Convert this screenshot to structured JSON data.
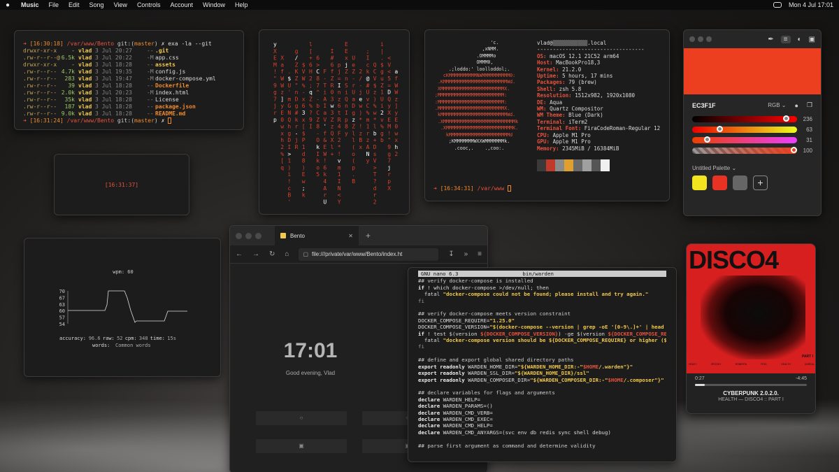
{
  "menubar": {
    "app": "Music",
    "items": [
      "File",
      "Edit",
      "Song",
      "View",
      "Controls",
      "Account",
      "Window",
      "Help"
    ],
    "datetime": "Mon 4 Jul  17:01"
  },
  "terminal1": {
    "prompt_time": "[16:30:18]",
    "path": "/var/www/Bento",
    "git_label": "git:(",
    "branch": "master",
    "git_close": ")",
    "cmd": "✗ exa -la --git",
    "rows": [
      {
        "perm": "drwxr-xr-x",
        "size": "-",
        "user": "vlad",
        "date": "3 Jul 20:27",
        "git": "--",
        "name": ".git",
        "kind": "dir"
      },
      {
        "perm": ".rw-r--r--@",
        "size": "6.5k",
        "user": "vlad",
        "date": "3 Jul 20:22",
        "git": "-M",
        "name": "app.css",
        "kind": "file"
      },
      {
        "perm": "drwxr-xr-x",
        "size": "-",
        "user": "vlad",
        "date": "3 Jul 18:28",
        "git": "--",
        "name": "assets",
        "kind": "dir"
      },
      {
        "perm": ".rw-r--r--",
        "size": "4.7k",
        "user": "vlad",
        "date": "3 Jul 19:35",
        "git": "-M",
        "name": "config.js",
        "kind": "file"
      },
      {
        "perm": ".rw-r--r--",
        "size": "283",
        "user": "vlad",
        "date": "3 Jul 19:47",
        "git": "-M",
        "name": "docker-compose.yml",
        "kind": "file"
      },
      {
        "perm": ".rw-r--r--",
        "size": "39",
        "user": "vlad",
        "date": "3 Jul 18:28",
        "git": "--",
        "name": "Dockerfile",
        "kind": "hl"
      },
      {
        "perm": ".rw-r--r--",
        "size": "2.0k",
        "user": "vlad",
        "date": "3 Jul 20:23",
        "git": "-M",
        "name": "index.html",
        "kind": "file"
      },
      {
        "perm": ".rw-r--r--",
        "size": "35k",
        "user": "vlad",
        "date": "3 Jul 18:28",
        "git": "--",
        "name": "License",
        "kind": "file"
      },
      {
        "perm": ".rw-r--r--",
        "size": "187",
        "user": "vlad",
        "date": "3 Jul 18:28",
        "git": "--",
        "name": "package.json",
        "kind": "hl"
      },
      {
        "perm": ".rw-r--r--",
        "size": "9.0k",
        "user": "vlad",
        "date": "3 Jul 18:28",
        "git": "--",
        "name": "README.md",
        "kind": "hl"
      }
    ],
    "prompt2_time": "[16:31:24]",
    "cmd2": "✗"
  },
  "clock_small": "[16:31:37]",
  "neofetch": {
    "user": "vlad@",
    "host_blur": "▒▒▒▒▒▒▒▒▒▒▒",
    "host_suffix": ".local",
    "separator": "----------------------------------",
    "info": [
      {
        "k": "OS",
        "v": "macOS 12.1 21C52 arm64"
      },
      {
        "k": "Host",
        "v": "MacBookPro18,3"
      },
      {
        "k": "Kernel",
        "v": "21.2.0"
      },
      {
        "k": "Uptime",
        "v": "5 hours, 17 mins"
      },
      {
        "k": "Packages",
        "v": "79 (brew)"
      },
      {
        "k": "Shell",
        "v": "zsh 5.8"
      },
      {
        "k": "Resolution",
        "v": "1512x982, 1920x1080"
      },
      {
        "k": "DE",
        "v": "Aqua"
      },
      {
        "k": "WM",
        "v": "Quartz Compositor"
      },
      {
        "k": "WM Theme",
        "v": "Blue (Dark)"
      },
      {
        "k": "Terminal",
        "v": "iTerm2"
      },
      {
        "k": "Terminal Font",
        "v": "FiraCodeRoman-Regular 12"
      },
      {
        "k": "CPU",
        "v": "Apple M1 Pro"
      },
      {
        "k": "GPU",
        "v": "Apple M1 Pro"
      },
      {
        "k": "Memory",
        "v": "2345MiB / 16384MiB"
      }
    ],
    "logo_lines": [
      "                    'c.",
      "                 ,xNMM.",
      "               .OMMMMo",
      "               OMMM0,",
      "     .;loddo:' loolloddol;.",
      "   cKMMMMMMMMMMNWMMMMMMMMMM0:",
      " .KMMMMMMMMMMMMMMMMMMMMMMMWd.",
      " XMMMMMMMMMMMMMMMMMMMMMMMX.",
      ";MMMMMMMMMMMMMMMMMMMMMMMM:",
      ":MMMMMMMMMMMMMMMMMMMMMMMM:",
      ".MMMMMMMMMMMMMMMMMMMMMMMMX.",
      " kMMMMMMMMMMMMMMMMMMMMMMMMWd.",
      " .XMMMMMMMMMMMMMMMMMMMMMMMMMMk",
      "  .XMMMMMMMMMMMMMMMMMMMMMMMMK.",
      "    kMMMMMMMMMMMMMMMMMMMMMMd",
      "     ;KMMMMMMMWXXWMMMMMMMk.",
      "       .cooc,.    .,coo:."
    ],
    "swatch_colors": [
      "#3a3a3a",
      "#c0392b",
      "#8a8a8a",
      "#e0a030",
      "#6a6a6a",
      "#a0a0a0",
      "#555555",
      "#f0f0f0"
    ],
    "prompt_time": "[16:34:31]",
    "prompt_path": "/var/www"
  },
  "picker": {
    "hex": "EC3F1F",
    "mode": "RGB",
    "color": "#EC3F1F",
    "sliders": [
      {
        "label": "236",
        "value": 236
      },
      {
        "label": "63",
        "value": 63
      },
      {
        "label": "31",
        "value": 31
      },
      {
        "label": "100",
        "value": 100
      }
    ],
    "palette_title": "Untitled Palette",
    "palette": [
      "#f2e41f",
      "#e83324",
      "#666666"
    ],
    "add_label": "+"
  },
  "typing": {
    "wpm_label": "wpm: 60",
    "y_ticks": [
      "70",
      "67",
      "63",
      "60",
      "57",
      "54"
    ],
    "stats_line1": [
      "accuracy:",
      "96.6",
      "raw:",
      "52",
      "cpm:",
      "348",
      "time:",
      "15s"
    ],
    "stats_line2": [
      "words:",
      "Common words"
    ]
  },
  "browser": {
    "tab_title": "Bento",
    "tab_close": "✕",
    "new_tab": "+",
    "url": "file:///private/var/www/Bento/index.ht",
    "time": "17:01",
    "greeting": "Good evening, Vlad"
  },
  "nano": {
    "app": "GNU nano 6.3",
    "file": "bin/warden",
    "lines": [
      [
        {
          "c": "cm",
          "t": "## verify docker-compose is installed"
        }
      ],
      [
        {
          "c": "kw",
          "t": "if "
        },
        {
          "c": "",
          "t": "! which docker-compose >/dev/null; then"
        }
      ],
      [
        {
          "c": "",
          "t": "  fatal "
        },
        {
          "c": "str",
          "t": "\"docker-compose could not be found; please install and try again.\""
        }
      ],
      [
        {
          "c": "dim",
          "t": "fi"
        }
      ],
      [
        {
          "c": "",
          "t": ""
        }
      ],
      [
        {
          "c": "cm",
          "t": "## verify docker-compose meets version constraint"
        }
      ],
      [
        {
          "c": "",
          "t": "DOCKER_COMPOSE_REQUIRE="
        },
        {
          "c": "str",
          "t": "\"1.25.0\""
        }
      ],
      [
        {
          "c": "",
          "t": "DOCKER_COMPOSE_VERSION="
        },
        {
          "c": "str",
          "t": "\"$(docker-compose --version | grep -oE '[0-9\\.]+' | head"
        }
      ],
      [
        {
          "c": "kw",
          "t": "if "
        },
        {
          "c": "",
          "t": "! test $(version "
        },
        {
          "c": "var",
          "t": "${DOCKER_COMPOSE_VERSION}"
        },
        {
          "c": "",
          "t": ") -ge $(version "
        },
        {
          "c": "var",
          "t": "${DOCKER_COMPOSE_RE"
        }
      ],
      [
        {
          "c": "",
          "t": "  fatal "
        },
        {
          "c": "str",
          "t": "\"docker-compose version should be ${DOCKER_COMPOSE_REQUIRE} or higher ($"
        }
      ],
      [
        {
          "c": "dim",
          "t": "fi"
        }
      ],
      [
        {
          "c": "",
          "t": ""
        }
      ],
      [
        {
          "c": "cm",
          "t": "## define and export global shared directory paths"
        }
      ],
      [
        {
          "c": "kw",
          "t": "export readonly "
        },
        {
          "c": "",
          "t": "WARDEN_HOME_DIR="
        },
        {
          "c": "str",
          "t": "\"${WARDEN_HOME_DIR:-\""
        },
        {
          "c": "var",
          "t": "$HOME"
        },
        {
          "c": "str",
          "t": "/.warden\"}\""
        }
      ],
      [
        {
          "c": "kw",
          "t": "export readonly "
        },
        {
          "c": "",
          "t": "WARDEN_SSL_DIR="
        },
        {
          "c": "str",
          "t": "\"${WARDEN_HOME_DIR}/ssl\""
        }
      ],
      [
        {
          "c": "kw",
          "t": "export readonly "
        },
        {
          "c": "",
          "t": "WARDEN_COMPOSER_DIR="
        },
        {
          "c": "str",
          "t": "\"${WARDEN_COMPOSER_DIR:-\""
        },
        {
          "c": "var",
          "t": "$HOME"
        },
        {
          "c": "str",
          "t": "/.composer\"}\""
        }
      ],
      [
        {
          "c": "",
          "t": ""
        }
      ],
      [
        {
          "c": "cm",
          "t": "## declare variables for flags and arguments"
        }
      ],
      [
        {
          "c": "kw",
          "t": "declare "
        },
        {
          "c": "",
          "t": "WARDEN_HELP="
        }
      ],
      [
        {
          "c": "kw",
          "t": "declare "
        },
        {
          "c": "",
          "t": "WARDEN_PARAMS=()"
        }
      ],
      [
        {
          "c": "kw",
          "t": "declare "
        },
        {
          "c": "",
          "t": "WARDEN_CMD_VERB="
        }
      ],
      [
        {
          "c": "kw",
          "t": "declare "
        },
        {
          "c": "",
          "t": "WARDEN_CMD_EXEC="
        }
      ],
      [
        {
          "c": "kw",
          "t": "declare "
        },
        {
          "c": "",
          "t": "WARDEN_CMD_HELP="
        }
      ],
      [
        {
          "c": "kw",
          "t": "declare "
        },
        {
          "c": "",
          "t": "WARDEN_CMD_ANYARGS=(svc env db redis sync shell debug)"
        }
      ],
      [
        {
          "c": "",
          "t": ""
        }
      ],
      [
        {
          "c": "cm",
          "t": "## parse first argument as command and determine validity"
        }
      ]
    ]
  },
  "music": {
    "album_title": "DISCO4",
    "album_part": "PART I",
    "track_list": [
      "HEAVY",
      "SPOOKY",
      "ROBERTA",
      "FEEL",
      "HEALTH",
      "UNREAL"
    ],
    "elapsed": "0:27",
    "remaining": "-4:45",
    "progress": 0.09,
    "song": "CYBERPUNK 2.0.2.0.",
    "artist": "HEALTH — DISCO4 :: PART I"
  },
  "matrix_chars": "y XE M!\"9g 7jr p X afW Wz] yE 0 w x h2% [q. $U' m G N QhgD I>1)i! c B 'g /ZK Z\"nDg # k r- jR $ V W% - x6 3x [$ P 1d8 ) Ew ;k l[ + 6H 2 ; q Z% ? 9 I 6 > C 8 7 ^ - b CZ 8 - Ok I k o 5F - T i AI a V ' f &EW ! 6 k 4A rUI # 6 f Z R 0 3 w 3Z z Q X l + p j=I n z 6 t R 4 F2* ! v m 1 I N < Y E Ex j Z n S i Q n Ip 8 y U e Z- rU a D g z Z ll( o ( p .B 2 / - j e w ) * ! z Bx ;I c k @ # U v C % m 1r z A N y Q C V $ z ) % w * l b + D s V > T ? d r 2 i | . $ g u Z 1 U i 2 v%g b < V < 5 = D Q"
}
